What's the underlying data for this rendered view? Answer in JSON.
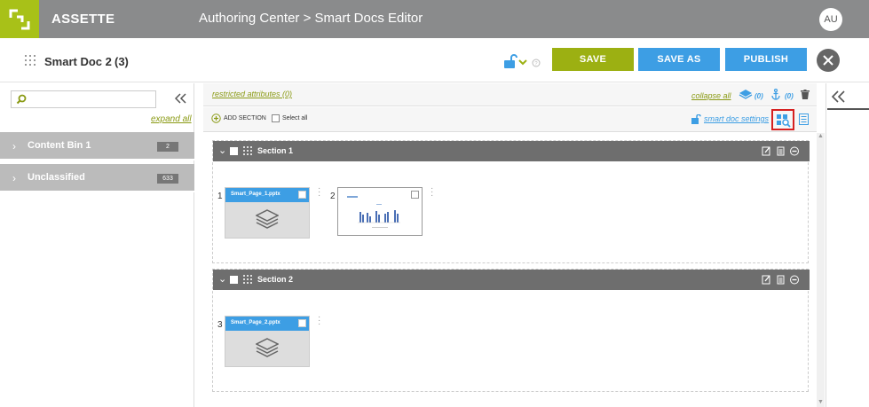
{
  "header": {
    "app_name": "ASSETTE",
    "breadcrumb": "Authoring Center > Smart Docs Editor",
    "avatar_initials": "AU",
    "brand_color": "#a8c118"
  },
  "doc": {
    "title": "Smart Doc 2",
    "count": "(3)",
    "save_label": "SAVE",
    "save_as_label": "SAVE AS",
    "publish_label": "PUBLISH"
  },
  "left": {
    "search_placeholder": "",
    "expand_all": "expand all",
    "bins": [
      {
        "label": "Content Bin 1",
        "count": "2"
      },
      {
        "label": "Unclassified",
        "count": "633"
      }
    ]
  },
  "toolbar": {
    "restricted": "restricted attributes (0)",
    "collapse_all": "collapse all",
    "layers_count": "(0)",
    "anchor_count": "(0)",
    "add_section": "ADD SECTION",
    "select_all": "Select all",
    "smart_doc_settings": "smart doc settings"
  },
  "sections": [
    {
      "title": "Section 1",
      "pages": [
        {
          "num": "1",
          "file": "Smart_Page_1.pptx"
        },
        {
          "num": "2",
          "file": ""
        }
      ]
    },
    {
      "title": "Section 2",
      "pages": [
        {
          "num": "3",
          "file": "Smart_Page_2.pptx"
        }
      ]
    }
  ]
}
